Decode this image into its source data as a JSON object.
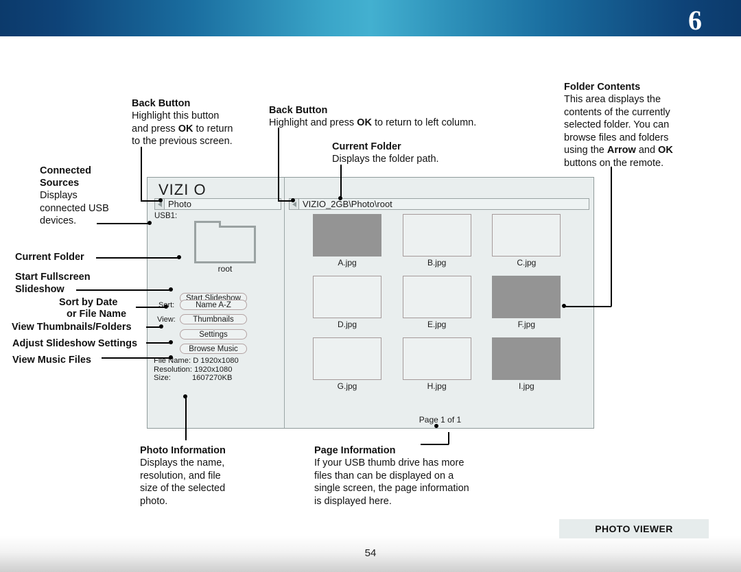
{
  "header": {
    "chapter_number": "6"
  },
  "footer": {
    "badge": "PHOTO VIEWER",
    "page_number": "54"
  },
  "annotations": {
    "back_button_left": {
      "title": "Back Button",
      "body_line1": "Highlight this button",
      "body_line2_pre": "and press ",
      "body_line2_bold": "OK",
      "body_line2_post": " to return",
      "body_line3": "to the previous screen."
    },
    "back_button_right": {
      "title": "Back Button",
      "body_pre": "Highlight and press ",
      "body_bold": "OK",
      "body_post": " to return to left column."
    },
    "current_folder_top": {
      "title": "Current Folder",
      "body": "Displays the folder path."
    },
    "folder_contents": {
      "title": "Folder Contents",
      "line1": "This area displays the",
      "line2": "contents of the currently",
      "line3": "selected folder. You can",
      "line4": "browse files and folders",
      "line5_pre": "using the ",
      "line5_bold1": "Arrow",
      "line5_mid": " and ",
      "line5_bold2": "OK",
      "line6": "buttons on the remote."
    },
    "connected_sources": {
      "title_line1": "Connected",
      "title_line2": "Sources",
      "body_line1": "Displays",
      "body_line2": "connected USB",
      "body_line3": "devices."
    },
    "photo_information": {
      "title": "Photo Information",
      "line1": "Displays the name,",
      "line2": "resolution, and file",
      "line3": "size of the selected",
      "line4": "photo."
    },
    "page_information": {
      "title": "Page Information",
      "line1": "If your USB thumb drive has more",
      "line2": "files than can be displayed on a",
      "line3": "single screen, the page information",
      "line4": "is displayed here."
    }
  },
  "side_labels": {
    "current_folder": "Current Folder",
    "start_fullscreen_line1": "Start Fullscreen",
    "start_fullscreen_line2": "Slideshow",
    "sort_line1": "Sort by Date",
    "sort_line2": "or File Name",
    "view_thumbnails": "View Thumbnails/Folders",
    "adjust_settings": "Adjust Slideshow Settings",
    "view_music": "View Music Files"
  },
  "tv_screen": {
    "brand": "VIZI O",
    "left_panel": {
      "back_label": "Photo",
      "usb_label": "USB1:",
      "folder_name": "root",
      "buttons": {
        "start_slideshow": "Start Slideshow",
        "sort_prefix": "Sort:",
        "sort_value": "Name A-Z",
        "view_prefix": "View:",
        "view_value": "Thumbnails",
        "settings": "Settings",
        "browse_music": "Browse Music"
      },
      "file_info": {
        "file_name": "File Name: D 1920x1080",
        "resolution": "Resolution: 1920x1080",
        "size": "Size:          1607270KB"
      }
    },
    "right_panel": {
      "path": "VIZIO_2GB\\Photo\\root",
      "page_info": "Page 1 of 1",
      "thumbnails": [
        {
          "label": "A.jpg",
          "filled": true
        },
        {
          "label": "B.jpg",
          "filled": false
        },
        {
          "label": "C.jpg",
          "filled": false
        },
        {
          "label": "D.jpg",
          "filled": false
        },
        {
          "label": "E.jpg",
          "filled": false
        },
        {
          "label": "F.jpg",
          "filled": true
        },
        {
          "label": "G.jpg",
          "filled": false
        },
        {
          "label": "H.jpg",
          "filled": false
        },
        {
          "label": "I.jpg",
          "filled": true
        }
      ]
    }
  },
  "colors": {
    "header_dark": "#0c3a6b",
    "header_light": "#43b0d0",
    "panel_bg": "#e9eeee",
    "thumb_filled": "#949494",
    "badge_bg": "#e6ecec"
  }
}
